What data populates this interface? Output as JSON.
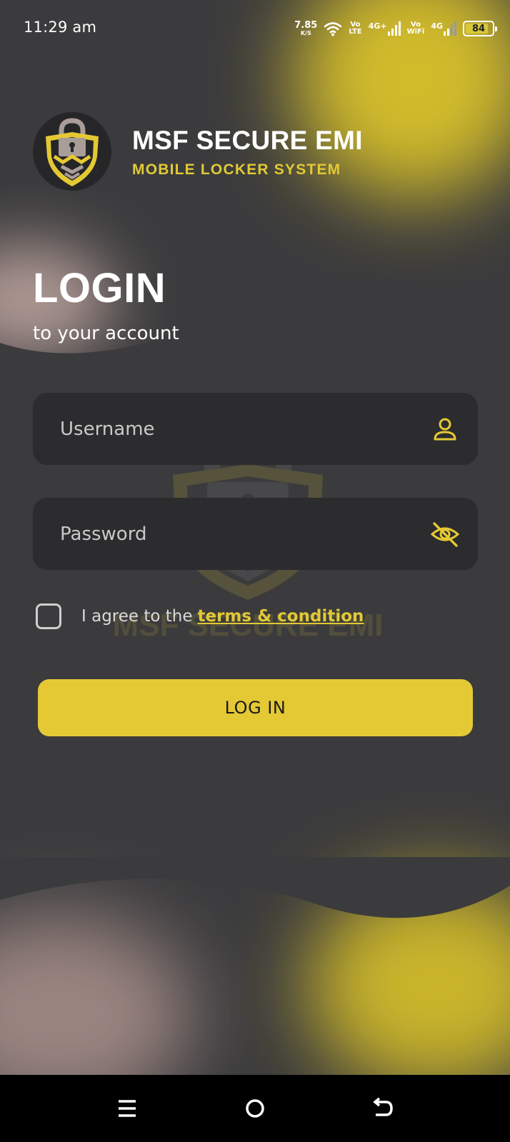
{
  "status_bar": {
    "time": "11:29 am",
    "speed_value": "7.85",
    "speed_unit": "K/S",
    "volte_top": "Vo",
    "volte_bottom": "LTE",
    "sim1_label": "4G+",
    "vowifi_top": "Vo",
    "vowifi_bottom": "WiFi",
    "sim2_label": "4G",
    "battery": "84"
  },
  "brand": {
    "logo_icon": "lock-shield-logo",
    "title": "MSF SECURE EMI",
    "subtitle": "MOBILE LOCKER SYSTEM",
    "watermark_text": "MSF SECURE EMI"
  },
  "heading": {
    "title": "LOGIN",
    "subtitle": "to your account"
  },
  "form": {
    "username_placeholder": "Username",
    "username_icon": "user-icon",
    "password_placeholder": "Password",
    "password_icon": "eye-off-icon",
    "agree_text": "I agree to the",
    "terms_link": "terms & condition",
    "agree_checked": false,
    "submit_label": "LOG IN"
  },
  "colors": {
    "accent": "#e5c934",
    "background": "#3b3b3d",
    "field": "#2c2c2e"
  },
  "nav": {
    "recents_icon": "menu-icon",
    "home_icon": "home-circle-icon",
    "back_icon": "back-icon"
  }
}
